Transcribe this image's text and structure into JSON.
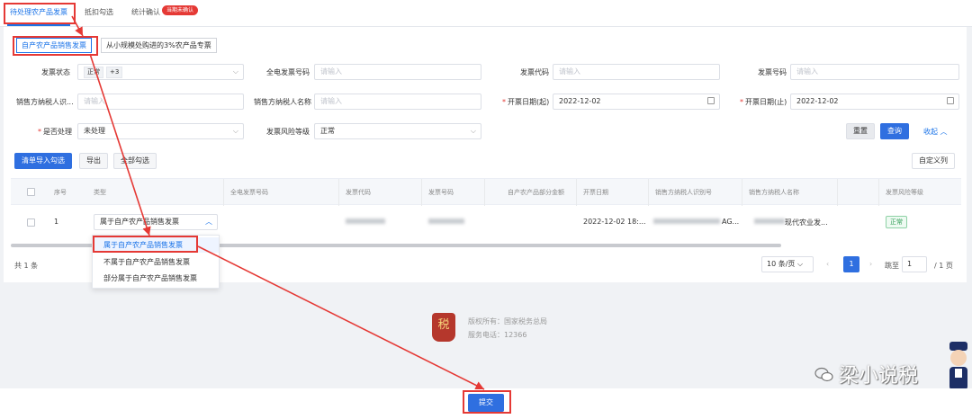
{
  "tabs": [
    {
      "label": "待处理农产品发票"
    },
    {
      "label": "抵扣勾选"
    },
    {
      "label": "统计确认"
    }
  ],
  "tab_badge": "当期未确认",
  "segments": [
    {
      "label": "自产农产品销售发票"
    },
    {
      "label": "从小规模处购进的3%农产品专票"
    }
  ],
  "filters": {
    "invoice_status": {
      "label": "发票状态",
      "tag": "正常",
      "more": "+3"
    },
    "digital_invoice_no": {
      "label": "全电发票号码",
      "placeholder": "请输入"
    },
    "invoice_code": {
      "label": "发票代码",
      "placeholder": "请输入"
    },
    "invoice_no": {
      "label": "发票号码",
      "placeholder": "请输入"
    },
    "seller_tax_id": {
      "label": "销售方纳税人识...",
      "placeholder": "请输入"
    },
    "seller_name": {
      "label": "销售方纳税人名称",
      "placeholder": "请输入"
    },
    "date_start": {
      "label": "开票日期(起)",
      "value": "2022-12-02"
    },
    "date_end": {
      "label": "开票日期(止)",
      "value": "2022-12-02"
    },
    "processed": {
      "label": "是否处理",
      "value": "未处理"
    },
    "risk_level": {
      "label": "发票风险等级",
      "value": "正常"
    }
  },
  "actions": {
    "reset": "重置",
    "search": "查询",
    "collapse": "收起"
  },
  "toolbar": {
    "import": "清单导入勾选",
    "export": "导出",
    "select_all": "全部勾选",
    "custom_columns": "自定义列"
  },
  "table": {
    "columns": [
      "序号",
      "类型",
      "全电发票号码",
      "发票代码",
      "发票号码",
      "自产农产品部分金额",
      "开票日期",
      "销售方纳税人识别号",
      "销售方纳税人名称",
      "发票风险等级"
    ],
    "rows": [
      {
        "index": "1",
        "type": "属于自产农产品销售发票",
        "date": "2022-12-02 18:...",
        "seller_id_suffix": "AG...",
        "seller_name_suffix": "现代农业发...",
        "risk": "正常"
      }
    ]
  },
  "dropdown_options": [
    "属于自产农产品销售发票",
    "不属于自产农产品销售发票",
    "部分属于自产农产品销售发票"
  ],
  "pagination": {
    "total": "共 1 条",
    "page_size": "10 条/页",
    "current": "1",
    "goto_label": "跳至",
    "goto_value": "1",
    "total_pages": "/ 1 页"
  },
  "footer": {
    "copyright": "版权所有：国家税务总局",
    "phone": "服务电话：12366",
    "logo_text": "税"
  },
  "watermark": "梁小说税",
  "submit": "提交",
  "colors": {
    "primary": "#2f6fe0",
    "highlight": "#e53935",
    "success": "#2e9c54"
  }
}
